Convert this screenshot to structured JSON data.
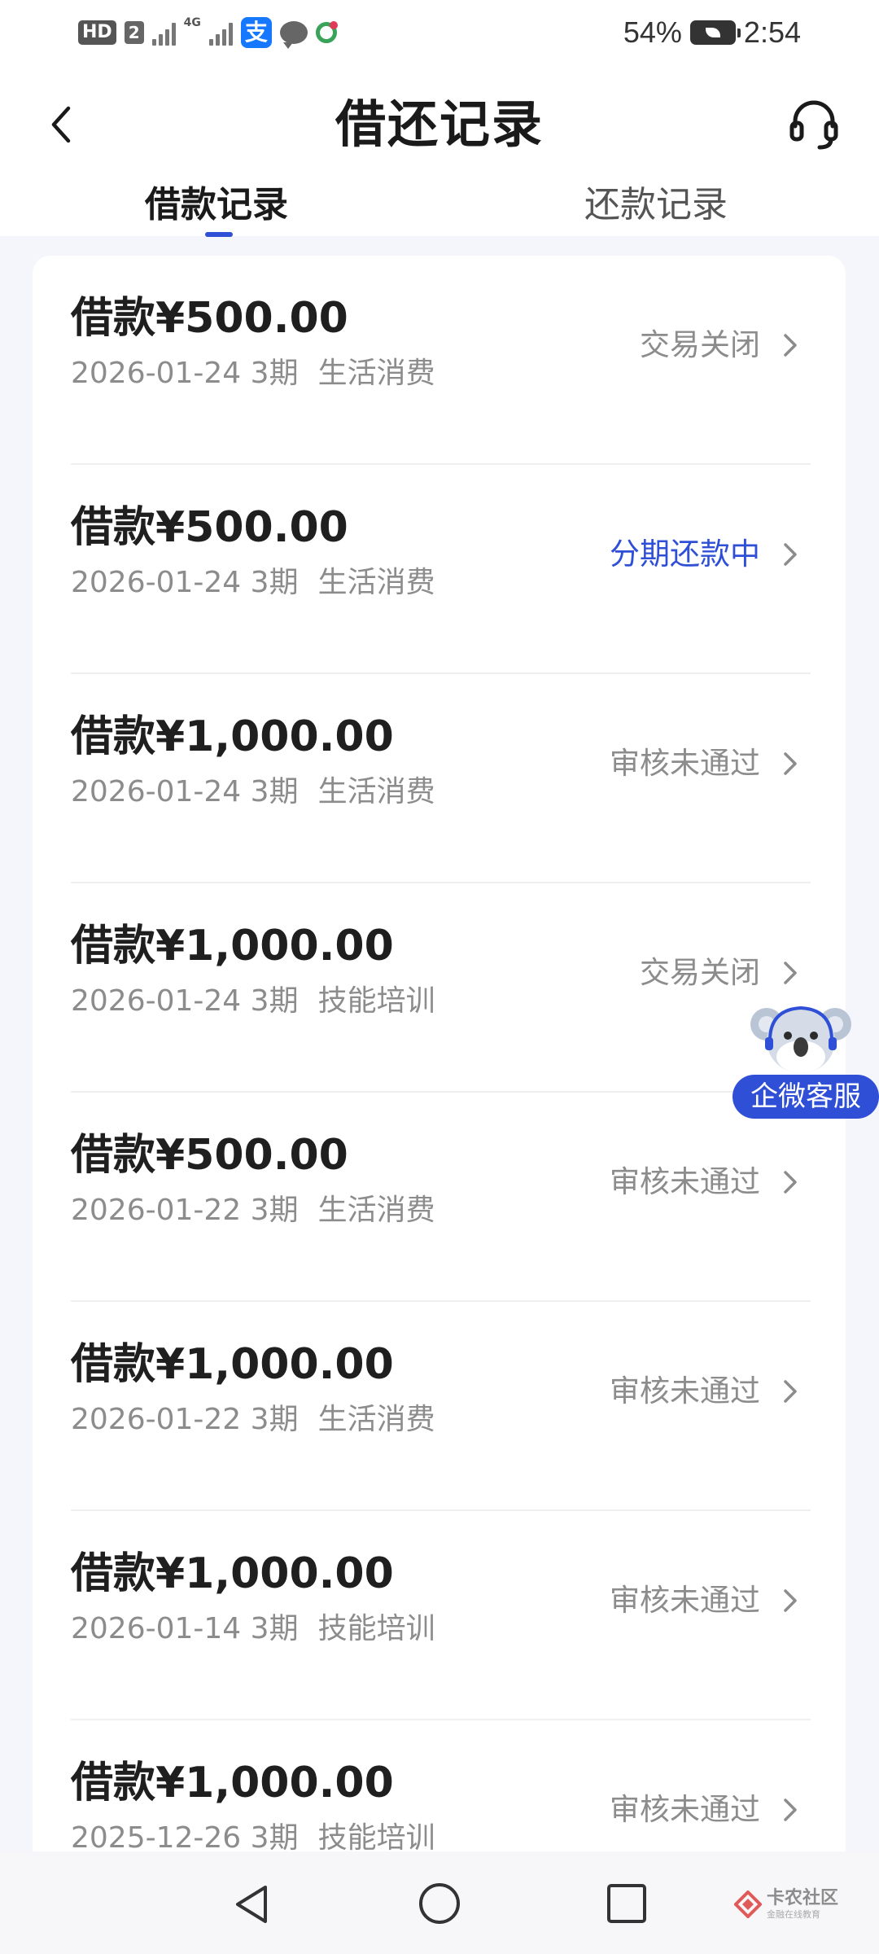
{
  "status_bar": {
    "hd": "HD",
    "sim": "2",
    "net_tag": "4G",
    "alipay_glyph": "支",
    "battery_percent": "54%",
    "time": "2:54"
  },
  "header": {
    "title": "借还记录",
    "back_icon": "chevron-left-icon",
    "service_icon": "headset-icon"
  },
  "tabs": [
    {
      "label": "借款记录",
      "active": true
    },
    {
      "label": "还款记录",
      "active": false
    }
  ],
  "records": [
    {
      "amount": "借款¥500.00",
      "date_term": "2026-01-24 3期",
      "purpose": "生活消费",
      "status": "交易关闭",
      "active": false
    },
    {
      "amount": "借款¥500.00",
      "date_term": "2026-01-24 3期",
      "purpose": "生活消费",
      "status": "分期还款中",
      "active": true
    },
    {
      "amount": "借款¥1,000.00",
      "date_term": "2026-01-24 3期",
      "purpose": "生活消费",
      "status": "审核未通过",
      "active": false
    },
    {
      "amount": "借款¥1,000.00",
      "date_term": "2026-01-24 3期",
      "purpose": "技能培训",
      "status": "交易关闭",
      "active": false
    },
    {
      "amount": "借款¥500.00",
      "date_term": "2026-01-22 3期",
      "purpose": "生活消费",
      "status": "审核未通过",
      "active": false
    },
    {
      "amount": "借款¥1,000.00",
      "date_term": "2026-01-22 3期",
      "purpose": "生活消费",
      "status": "审核未通过",
      "active": false
    },
    {
      "amount": "借款¥1,000.00",
      "date_term": "2026-01-14 3期",
      "purpose": "技能培训",
      "status": "审核未通过",
      "active": false
    },
    {
      "amount": "借款¥1,000.00",
      "date_term": "2025-12-26 3期",
      "purpose": "技能培训",
      "status": "审核未通过",
      "active": false
    }
  ],
  "float_service": {
    "label": "企微客服",
    "icon": "koala-mascot-icon"
  },
  "nav_bar": {
    "back_icon": "triangle-back-icon",
    "home_icon": "circle-home-icon",
    "recents_icon": "square-recents-icon"
  },
  "watermark": {
    "main": "卡农社区",
    "sub": "金融在线教育"
  },
  "colors": {
    "accent": "#2f4fd6",
    "text_primary": "#1f1f1f",
    "text_secondary": "#8c8c8c",
    "background": "#f4f6fb"
  }
}
